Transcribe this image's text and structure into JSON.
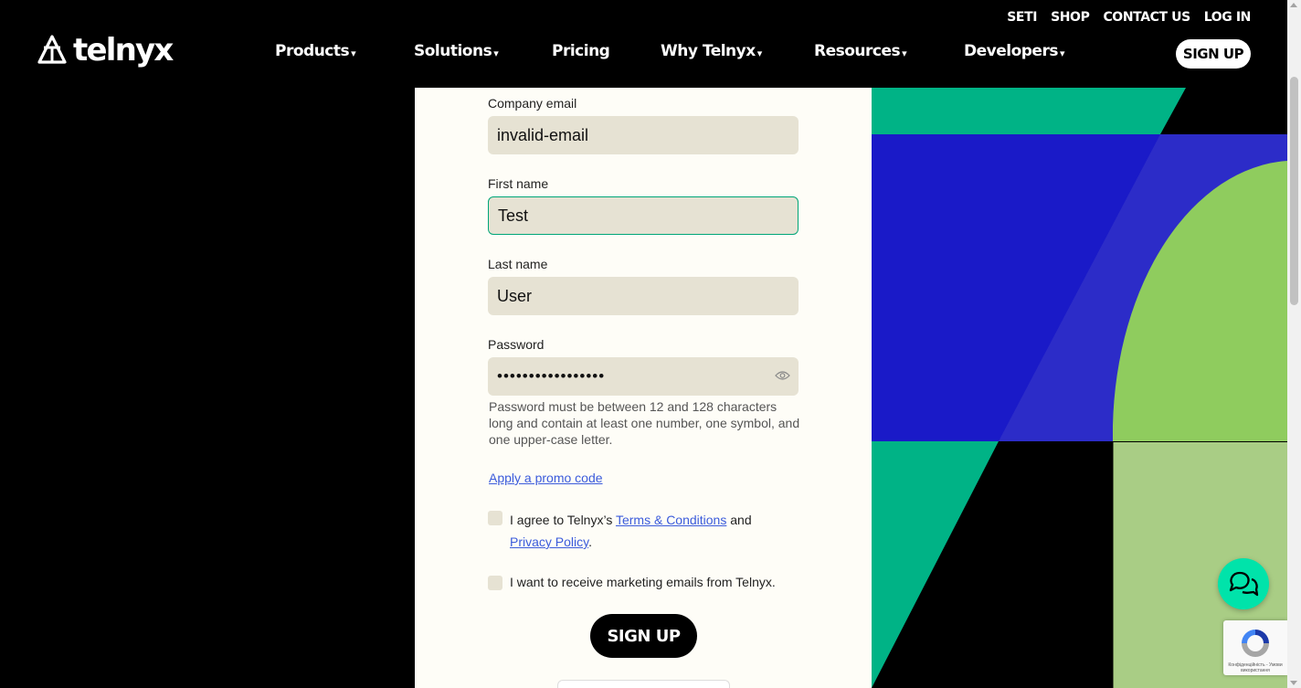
{
  "header": {
    "logo_text": "telnyx",
    "util_links": [
      "SETI",
      "SHOP",
      "CONTACT US",
      "LOG IN"
    ],
    "nav": [
      {
        "label": "Products",
        "has_caret": true
      },
      {
        "label": "Solutions",
        "has_caret": true
      },
      {
        "label": "Pricing",
        "has_caret": false
      },
      {
        "label": "Why Telnyx",
        "has_caret": true
      },
      {
        "label": "Resources",
        "has_caret": true
      },
      {
        "label": "Developers",
        "has_caret": true
      }
    ],
    "caret": "▾",
    "signup_label": "SIGN UP"
  },
  "form": {
    "email": {
      "label": "Company email",
      "value": "invalid-email"
    },
    "first_name": {
      "label": "First name",
      "value": "Test"
    },
    "last_name": {
      "label": "Last name",
      "value": "User"
    },
    "password": {
      "label": "Password",
      "value_masked": "•••••••••••••••••"
    },
    "password_help": "Password must be between 12 and 128 characters long and contain at least one number, one symbol, and one upper-case letter.",
    "promo_link": "Apply a promo code",
    "terms": {
      "prefix": "I agree to Telnyx’s ",
      "terms_link": "Terms & Conditions",
      "middle": " and ",
      "privacy_link": "Privacy Policy",
      "suffix": "."
    },
    "marketing_label": "I want to receive marketing emails from Telnyx.",
    "submit_label": "SIGN UP"
  },
  "recaptcha": {
    "text": "Конфіденційність - Умови використання"
  },
  "colors": {
    "accent_green": "#00e3aa",
    "panel_bg": "#fefdf7",
    "input_bg": "#e6e2d3",
    "link_blue": "#3b5bdb",
    "art_green": "#00b386",
    "art_blue": "#1a1ac8",
    "art_blue_light": "#2c2cc8",
    "art_lime": "#8fcc5e",
    "art_lime_light": "#a9cd85"
  }
}
